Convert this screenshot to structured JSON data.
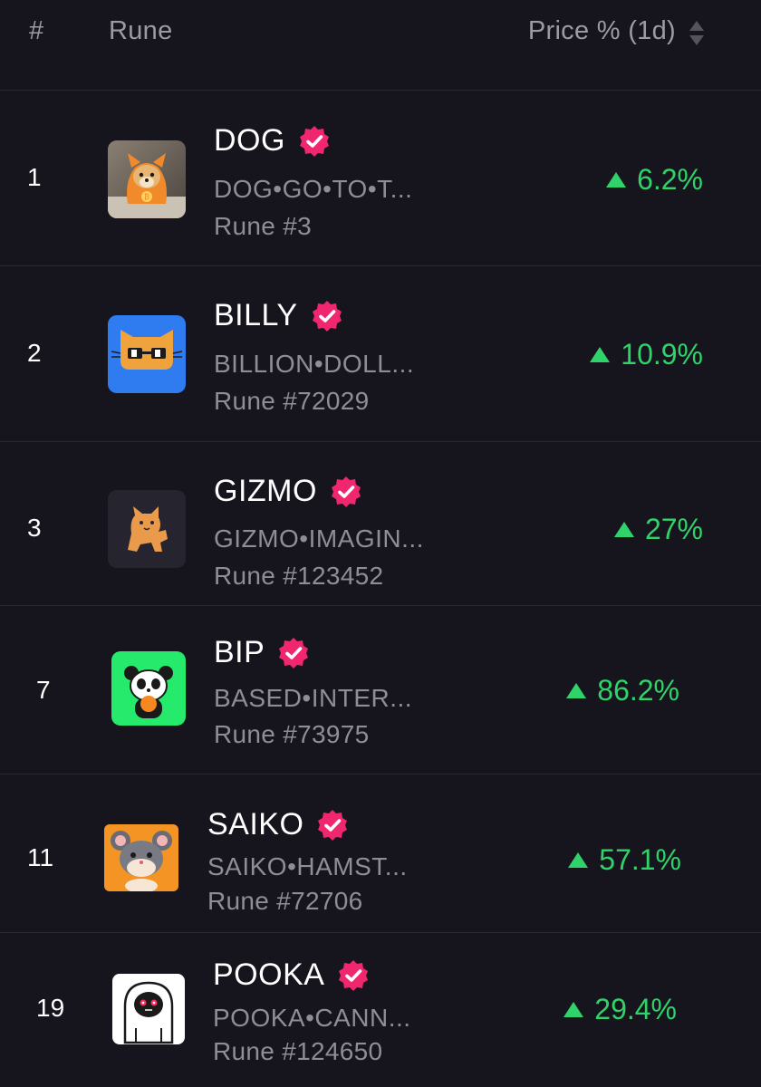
{
  "header": {
    "rank_label": "#",
    "rune_label": "Rune",
    "price_label": "Price % (1d)",
    "sort_icon": "sort-updown-icon"
  },
  "rows": [
    {
      "rank": "1",
      "name": "DOG",
      "full_name": "DOG•GO•TO•T...",
      "rune_id": "Rune #3",
      "change": "6.2%",
      "logo": "dog-logo"
    },
    {
      "rank": "2",
      "name": "BILLY",
      "full_name": "BILLION•DOLL...",
      "rune_id": "Rune #72029",
      "change": "10.9%",
      "logo": "billy-logo"
    },
    {
      "rank": "3",
      "name": "GIZMO",
      "full_name": "GIZMO•IMAGIN...",
      "rune_id": "Rune #123452",
      "change": "27%",
      "logo": "gizmo-logo"
    },
    {
      "rank": "7",
      "name": "BIP",
      "full_name": "BASED•INTER...",
      "rune_id": "Rune #73975",
      "change": "86.2%",
      "logo": "bip-logo"
    },
    {
      "rank": "11",
      "name": "SAIKO",
      "full_name": "SAIKO•HAMST...",
      "rune_id": "Rune #72706",
      "change": "57.1%",
      "logo": "saiko-logo"
    },
    {
      "rank": "19",
      "name": "POOKA",
      "full_name": "POOKA•CANN...",
      "rune_id": "Rune #124650",
      "change": "29.4%",
      "logo": "pooka-logo"
    }
  ],
  "colors": {
    "background": "#16151d",
    "positive": "#2fd36a",
    "verified_badge": "#f0266f",
    "muted_text": "#8e8d98"
  },
  "icons": {
    "verified": "verified-check-icon",
    "up_arrow": "up-triangle-icon"
  }
}
